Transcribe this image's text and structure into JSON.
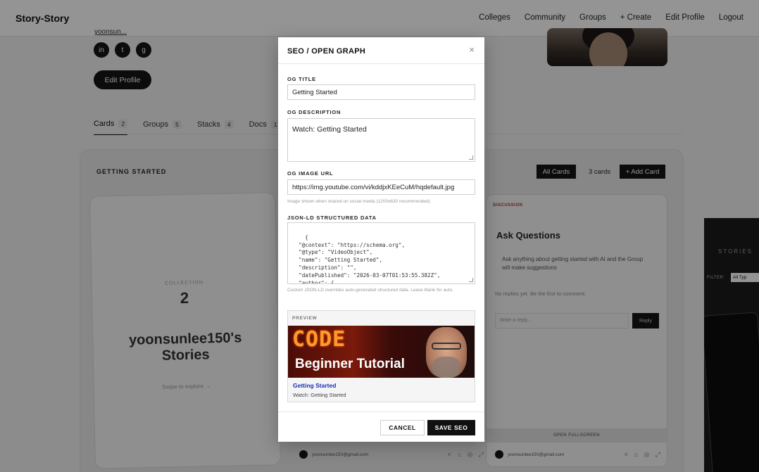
{
  "app": {
    "brand": "Story-Story",
    "nav": [
      "Colleges",
      "Community",
      "Groups",
      "+ Create",
      "Edit Profile",
      "Logout"
    ]
  },
  "profile": {
    "email_fragment": "yoonsun...",
    "social_icons": [
      "linkedin-icon",
      "twitter-icon",
      "github-icon"
    ],
    "edit_button": "Edit Profile"
  },
  "tabs": [
    {
      "label": "Cards",
      "count": "2",
      "active": true
    },
    {
      "label": "Groups",
      "count": "5"
    },
    {
      "label": "Stacks",
      "count": "4"
    },
    {
      "label": "Docs",
      "count": "1"
    }
  ],
  "collection": {
    "title": "GETTING STARTED",
    "all_cards": "All Cards",
    "cards_count": "3 cards",
    "add_card": "+ Add Card",
    "card": {
      "label": "COLLECTION",
      "number": "2",
      "name": "yoonsunlee150's Stories",
      "swipe": "Swipe to explore →"
    },
    "discussion": {
      "tag": "DISCUSSION",
      "heading": "Ask Questions",
      "description": "Ask anything about getting started with AI and the Group will make suggestions",
      "no_replies": "No replies yet. Be the first to comment.",
      "reply_placeholder": "Write a reply...",
      "reply_button": "Reply",
      "open_fullscreen": "OPEN FULLSCREEN"
    },
    "footer_email": "yoonsunlee150@gmail.com"
  },
  "stories_panel": {
    "title": "STORIES",
    "filter_label": "FILTER:",
    "filter_value": "All Typ"
  },
  "modal": {
    "title": "SEO / OPEN GRAPH",
    "close": "×",
    "og_title_label": "OG TITLE",
    "og_title_value": "Getting Started",
    "og_description_label": "OG DESCRIPTION",
    "og_description_value": "Watch: Getting Started",
    "og_image_label": "OG IMAGE URL",
    "og_image_value": "https://img.youtube.com/vi/kddjxKEeCuM/hqdefault.jpg",
    "og_image_hint": "Image shown when shared on social media (1200x630 recommended).",
    "jsonld_label": "JSON-LD STRUCTURED DATA",
    "jsonld_value": "{\n  \"@context\": \"https://schema.org\",\n  \"@type\": \"VideoObject\",\n  \"name\": \"Getting Started\",\n  \"description\": \"\",\n  \"datePublished\": \"2026-03-07T01:53:55.382Z\",\n  \"author\": {",
    "jsonld_hint": "Custom JSON-LD overrides auto-generated structured data. Leave blank for auto.",
    "preview_label": "PREVIEW",
    "preview_image_text_top": "CODE",
    "preview_image_text_bottom": "Beginner Tutorial",
    "preview_title": "Getting Started",
    "preview_desc": "Watch: Getting Started",
    "cancel": "CANCEL",
    "save": "SAVE SEO"
  }
}
